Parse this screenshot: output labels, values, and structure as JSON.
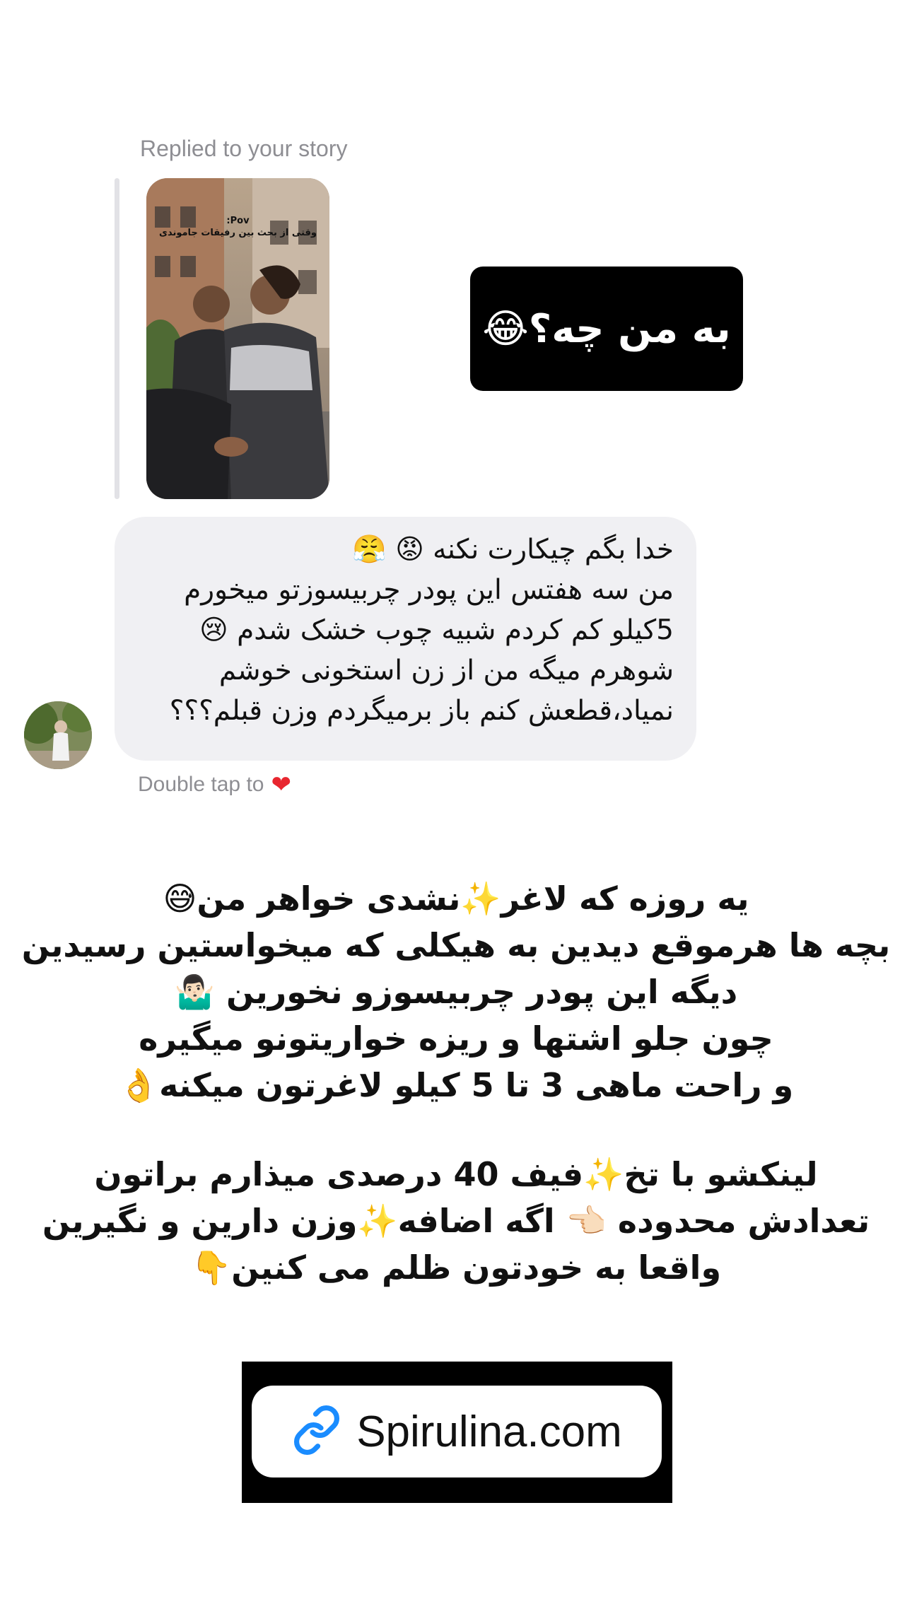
{
  "story_reply": {
    "label": "Replied to your story",
    "thumbnail_text_line1": "Pov:",
    "thumbnail_text_line2": "وقتی از بحث بین رفیقات جاموندی"
  },
  "sticker": {
    "text": "به من چه؟😂"
  },
  "message": {
    "lines": [
      "خدا بگم چیکارت نکنه 😡 😤",
      "من سه هفتس این پودر چربیسوزتو میخورم",
      "5کیلو کم کردم شبیه چوب خشک شدم 😢",
      "شوهرم میگه من از زن استخونی خوشم",
      "نمیاد،قطعش کنم باز برمیگردم وزن قبلم؟؟؟"
    ],
    "double_tap_label": "Double tap to",
    "heart_icon": "heart-icon"
  },
  "caption_top": {
    "lines": [
      "یه روزه که لاغر✨نشدی خواهر من😅",
      "بچه ها هرموقع دیدین به هیکلی که میخواستین رسیدین",
      "دیگه این پودر چربیسوزو نخورین 🤷🏻‍♂️",
      "چون جلو اشتها و ریزه خواریتونو میگیره",
      "و راحت ماهی 3 تا 5 کیلو لاغرتون میکنه👌"
    ]
  },
  "caption_bottom": {
    "lines": [
      "لینکشو با تخ✨فیف 40 درصدی میذارم براتون",
      "تعدادش محدوده 👈🏻 اگه اضافه✨وزن دارین و نگیرین",
      "واقعا به خودتون ظلم می کنین👇"
    ]
  },
  "link_sticker": {
    "text": "Spirulina.com",
    "icon": "link-icon",
    "accent_color": "#1a8cff"
  }
}
